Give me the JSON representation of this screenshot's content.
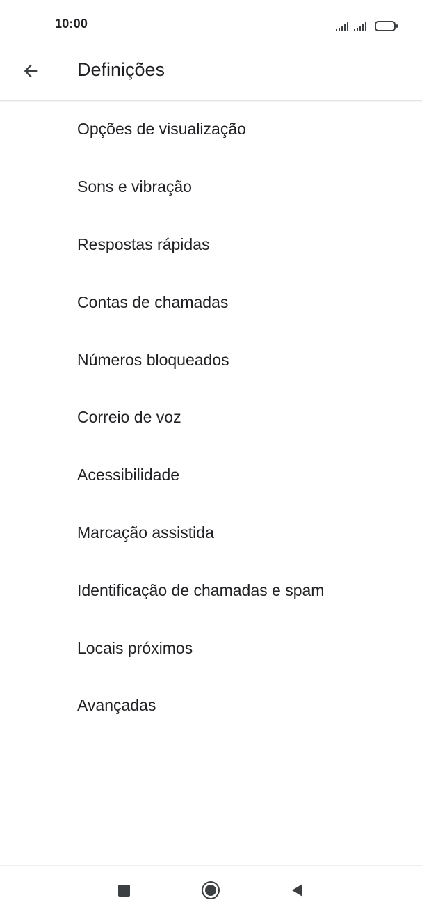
{
  "status_bar": {
    "time": "10:00",
    "icons": [
      "signal-icon",
      "signal-icon",
      "battery-icon"
    ]
  },
  "app_bar": {
    "title": "Definições",
    "back_icon": "arrow-left-icon"
  },
  "settings": {
    "items": [
      {
        "label": "Opções de visualização"
      },
      {
        "label": "Sons e vibração"
      },
      {
        "label": "Respostas rápidas"
      },
      {
        "label": "Contas de chamadas"
      },
      {
        "label": "Números bloqueados"
      },
      {
        "label": "Correio de voz"
      },
      {
        "label": "Acessibilidade"
      },
      {
        "label": "Marcação assistida"
      },
      {
        "label": "Identificação de chamadas e spam"
      },
      {
        "label": "Locais próximos"
      },
      {
        "label": "Avançadas"
      }
    ]
  },
  "nav_bar": {
    "icons": [
      "recent-apps-icon",
      "home-icon",
      "back-triangle-icon"
    ]
  },
  "colors": {
    "text": "#202124",
    "icon": "#3c4043",
    "divider": "#e4e4e4",
    "background": "#ffffff"
  }
}
